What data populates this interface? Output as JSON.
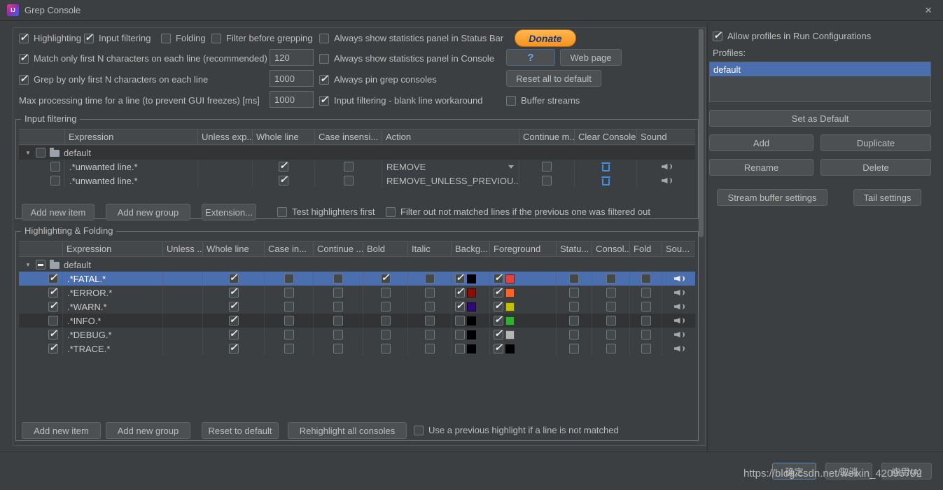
{
  "colors": {
    "selection": "#4b6eaf",
    "donate": "#f6921f",
    "trash_blue": "#3e8de8"
  },
  "icons": {
    "collapse": "▼"
  },
  "window": {
    "title": "Grep Console",
    "close": "×",
    "app_icon": "IJ"
  },
  "top": {
    "highlighting": {
      "label": "Highlighting",
      "checked": true
    },
    "input_filtering": {
      "label": "Input filtering",
      "checked": true
    },
    "folding": {
      "label": "Folding",
      "checked": false
    },
    "filter_before": {
      "label": "Filter before grepping",
      "checked": false
    },
    "stats_status_bar": {
      "label": "Always show statistics panel in Status Bar",
      "checked": false
    },
    "donate": "Donate",
    "match_n": {
      "label": "Match only first N characters on each line (recommended)",
      "checked": true,
      "value": "120"
    },
    "stats_console": {
      "label": "Always show statistics panel in Console",
      "checked": false
    },
    "help": "?",
    "web_page": "Web page",
    "grep_n": {
      "label": "Grep by only first N characters on each line",
      "checked": true,
      "value": "1000"
    },
    "pin_consoles": {
      "label": "Always pin grep consoles",
      "checked": true
    },
    "reset_all": "Reset all to default",
    "max_time": {
      "label": "Max processing time for a line (to prevent GUI freezes) [ms]",
      "value": "1000"
    },
    "blank_line": {
      "label": "Input filtering - blank line workaround",
      "checked": true
    },
    "buffer_streams": {
      "label": "Buffer streams",
      "checked": false
    }
  },
  "filter": {
    "title": "Input filtering",
    "col_expression": "Expression",
    "col_unless": "Unless exp...",
    "col_whole_line": "Whole line",
    "col_case": "Case insensi...",
    "col_action": "Action",
    "col_continue": "Continue m...",
    "col_clear": "Clear Console",
    "col_sound": "Sound",
    "group": {
      "label": "default",
      "checked": false
    },
    "rows": [
      {
        "enabled": false,
        "expression": ".*unwanted line.*",
        "whole_line": true,
        "case_insensitive": false,
        "action": "REMOVE",
        "continue_matching": false
      },
      {
        "enabled": false,
        "expression": ".*unwanted line.*",
        "whole_line": true,
        "case_insensitive": false,
        "action": "REMOVE_UNLESS_PREVIOU...",
        "continue_matching": false
      }
    ],
    "add_item": "Add new item",
    "add_group": "Add new group",
    "extension": "Extension...",
    "test_highlighters": {
      "label": "Test highlighters first",
      "checked": false
    },
    "filter_out": {
      "label": "Filter out not matched lines if the previous one was filtered out",
      "checked": false
    }
  },
  "hl": {
    "title": "Highlighting & Folding",
    "col_expression": "Expression",
    "col_unless": "Unless ...",
    "col_whole_line": "Whole line",
    "col_case": "Case in...",
    "col_continue": "Continue ...",
    "col_bold": "Bold",
    "col_italic": "Italic",
    "col_background": "Backg...",
    "col_foreground": "Foreground",
    "col_status": "Statu...",
    "col_console": "Consol...",
    "col_fold": "Fold",
    "col_sound": "Sou...",
    "group": {
      "label": "default",
      "checked": "mixed"
    },
    "rows": [
      {
        "enabled": true,
        "expression": ".*FATAL.*",
        "whole_line": true,
        "case_insensitive": false,
        "continue_matching": false,
        "bold": true,
        "italic": false,
        "background_checked": true,
        "background_color": "#000000",
        "foreground_checked": true,
        "foreground_color": "#e8413c",
        "status_bar": false,
        "console_count": false,
        "fold": false,
        "selected": true
      },
      {
        "enabled": true,
        "expression": ".*ERROR.*",
        "whole_line": true,
        "case_insensitive": false,
        "continue_matching": false,
        "bold": false,
        "italic": false,
        "background_checked": true,
        "background_color": "#8b0e04",
        "foreground_checked": true,
        "foreground_color": "#ff6126",
        "status_bar": false,
        "console_count": false,
        "fold": false,
        "selected": false
      },
      {
        "enabled": true,
        "expression": ".*WARN.*",
        "whole_line": true,
        "case_insensitive": false,
        "continue_matching": false,
        "bold": false,
        "italic": false,
        "background_checked": true,
        "background_color": "#2d0a75",
        "foreground_checked": true,
        "foreground_color": "#c0c000",
        "status_bar": false,
        "console_count": false,
        "fold": false,
        "selected": false
      },
      {
        "enabled": false,
        "expression": ".*INFO.*",
        "whole_line": true,
        "case_insensitive": false,
        "continue_matching": false,
        "bold": false,
        "italic": false,
        "background_checked": false,
        "background_color": "#000000",
        "foreground_checked": true,
        "foreground_color": "#30b030",
        "status_bar": false,
        "console_count": false,
        "fold": false,
        "selected": false
      },
      {
        "enabled": true,
        "expression": ".*DEBUG.*",
        "whole_line": true,
        "case_insensitive": false,
        "continue_matching": false,
        "bold": false,
        "italic": false,
        "background_checked": false,
        "background_color": "#000000",
        "foreground_checked": true,
        "foreground_color": "#b5b5b5",
        "status_bar": false,
        "console_count": false,
        "fold": false,
        "selected": false
      },
      {
        "enabled": true,
        "expression": ".*TRACE.*",
        "whole_line": true,
        "case_insensitive": false,
        "continue_matching": false,
        "bold": false,
        "italic": false,
        "background_checked": false,
        "background_color": "#000000",
        "foreground_checked": true,
        "foreground_color": "#000000",
        "status_bar": false,
        "console_count": false,
        "fold": false,
        "selected": false
      }
    ],
    "add_item": "Add new item",
    "add_group": "Add new group",
    "reset": "Reset to default",
    "rehighlight": "Rehighlight all consoles",
    "use_previous": {
      "label": "Use a previous highlight if a line is not matched",
      "checked": false
    }
  },
  "profiles": {
    "allow": {
      "label": "Allow profiles in Run Configurations",
      "checked": true
    },
    "label": "Profiles:",
    "items": [
      {
        "name": "default",
        "selected": true
      }
    ],
    "set_default": "Set as Default",
    "add": "Add",
    "duplicate": "Duplicate",
    "rename": "Rename",
    "delete": "Delete",
    "stream_buffer": "Stream buffer settings",
    "tail": "Tail settings"
  },
  "footer": {
    "ok": "确定",
    "cancel": "取消",
    "apply": "应用(A)",
    "watermark": "https://blog.csdn.net/weixin_42096792"
  }
}
